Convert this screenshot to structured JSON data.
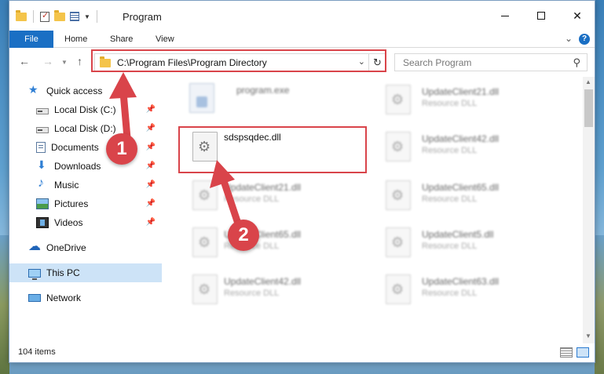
{
  "window": {
    "title": "Program"
  },
  "ribbon": {
    "file": "File",
    "home": "Home",
    "share": "Share",
    "view": "View"
  },
  "address": {
    "path": "C:\\Program Files\\Program Directory"
  },
  "search": {
    "placeholder": "Search Program"
  },
  "sidebar": {
    "items": [
      {
        "label": "Quick access",
        "icon": "star-icon",
        "pinned": false
      },
      {
        "label": "Local Disk (C:)",
        "icon": "drive-icon",
        "pinned": true
      },
      {
        "label": "Local Disk (D:)",
        "icon": "drive-icon",
        "pinned": true
      },
      {
        "label": "Documents",
        "icon": "documents-icon",
        "pinned": true
      },
      {
        "label": "Downloads",
        "icon": "download-icon",
        "pinned": true
      },
      {
        "label": "Music",
        "icon": "music-icon",
        "pinned": true
      },
      {
        "label": "Pictures",
        "icon": "pictures-icon",
        "pinned": true
      },
      {
        "label": "Videos",
        "icon": "videos-icon",
        "pinned": true
      },
      {
        "label": "OneDrive",
        "icon": "onedrive-icon",
        "pinned": false
      },
      {
        "label": "This PC",
        "icon": "computer-icon",
        "pinned": false,
        "selected": true
      },
      {
        "label": "Network",
        "icon": "network-icon",
        "pinned": false
      }
    ]
  },
  "files": {
    "left": [
      {
        "name": "program.exe",
        "sub": "",
        "blurred": true
      },
      {
        "name": "sdspsqdec.dll",
        "sub": "",
        "blurred": false
      },
      {
        "name": "UpdateClient21.dll",
        "sub": "Resource DLL",
        "blurred": true
      },
      {
        "name": "UpdateClient65.dll",
        "sub": "Resource DLL",
        "blurred": true
      },
      {
        "name": "UpdateClient42.dll",
        "sub": "Resource DLL",
        "blurred": true
      }
    ],
    "right": [
      {
        "name": "UpdateClient21.dll",
        "sub": "Resource DLL",
        "blurred": true
      },
      {
        "name": "UpdateClient42.dll",
        "sub": "Resource DLL",
        "blurred": true
      },
      {
        "name": "UpdateClient65.dll",
        "sub": "Resource DLL",
        "blurred": true
      },
      {
        "name": "UpdateClient5.dll",
        "sub": "Resource DLL",
        "blurred": true
      },
      {
        "name": "UpdateClient63.dll",
        "sub": "Resource DLL",
        "blurred": true
      }
    ]
  },
  "status": {
    "count": "104 items"
  },
  "callouts": {
    "one": "1",
    "two": "2",
    "color": "#d9444a"
  }
}
